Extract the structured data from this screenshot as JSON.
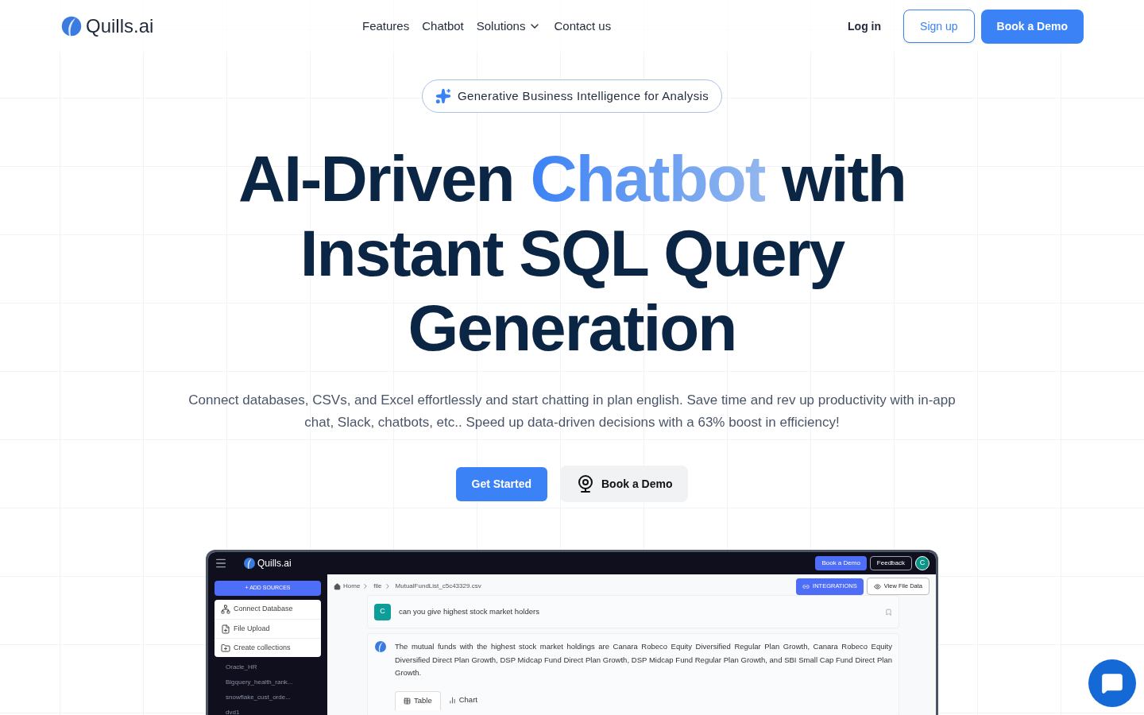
{
  "nav": {
    "brand": "Quills.ai",
    "links": [
      {
        "label": "Features",
        "kind": "link"
      },
      {
        "label": "Chatbot",
        "kind": "link"
      },
      {
        "label": "Solutions",
        "kind": "dropdown"
      },
      {
        "label": "Contact us",
        "kind": "link"
      }
    ],
    "login": "Log in",
    "signup": "Sign up",
    "demo": "Book a Demo"
  },
  "hero": {
    "badge": "Generative Business Intelligence for Analysis",
    "title_before": "AI-Driven ",
    "title_highlight": "Chatbot",
    "title_after": " with Instant SQL Query Generation",
    "subtitle": "Connect databases, CSVs, and Excel effortlessly and start chatting in plan english. Save time and rev up productivity with in-app chat, Slack, chatbots, etc.. Speed up data-driven decisions with a 63% boost in efficiency!",
    "primary": "Get Started",
    "secondary": "Book a Demo"
  },
  "app": {
    "brand": "Quills.ai",
    "demo": "Book a Demo",
    "feedback": "Feedback",
    "avatar": "C",
    "add_sources": "+ ADD SOURCES",
    "menu": [
      "Connect Database",
      "File Upload",
      "Create collections"
    ],
    "sources": [
      "Oracle_HR",
      "Bigquery_health_rank...",
      "snowflake_cust_orde...",
      "dvd1"
    ],
    "breadcrumb": [
      "Home",
      "file",
      "MutualFundList_c5c43329.csv"
    ],
    "integrations": "INTEGRATIONS",
    "view_file": "View File Data",
    "question_avatar": "C",
    "question": "can you give highest stock market holders",
    "answer": "The mutual funds with the highest stock market holdings are Canara Robeco Equity Diversified Regular Plan Growth, Canara Robeco Equity Diversified Direct Plan Growth, DSP Midcap Fund Direct Plan Growth, DSP Midcap Fund Regular Plan Growth, and SBI Small Cap Fund Direct Plan Growth.",
    "tabs": [
      {
        "label": "Table",
        "selected": true
      },
      {
        "label": "Chart",
        "selected": false
      }
    ]
  }
}
